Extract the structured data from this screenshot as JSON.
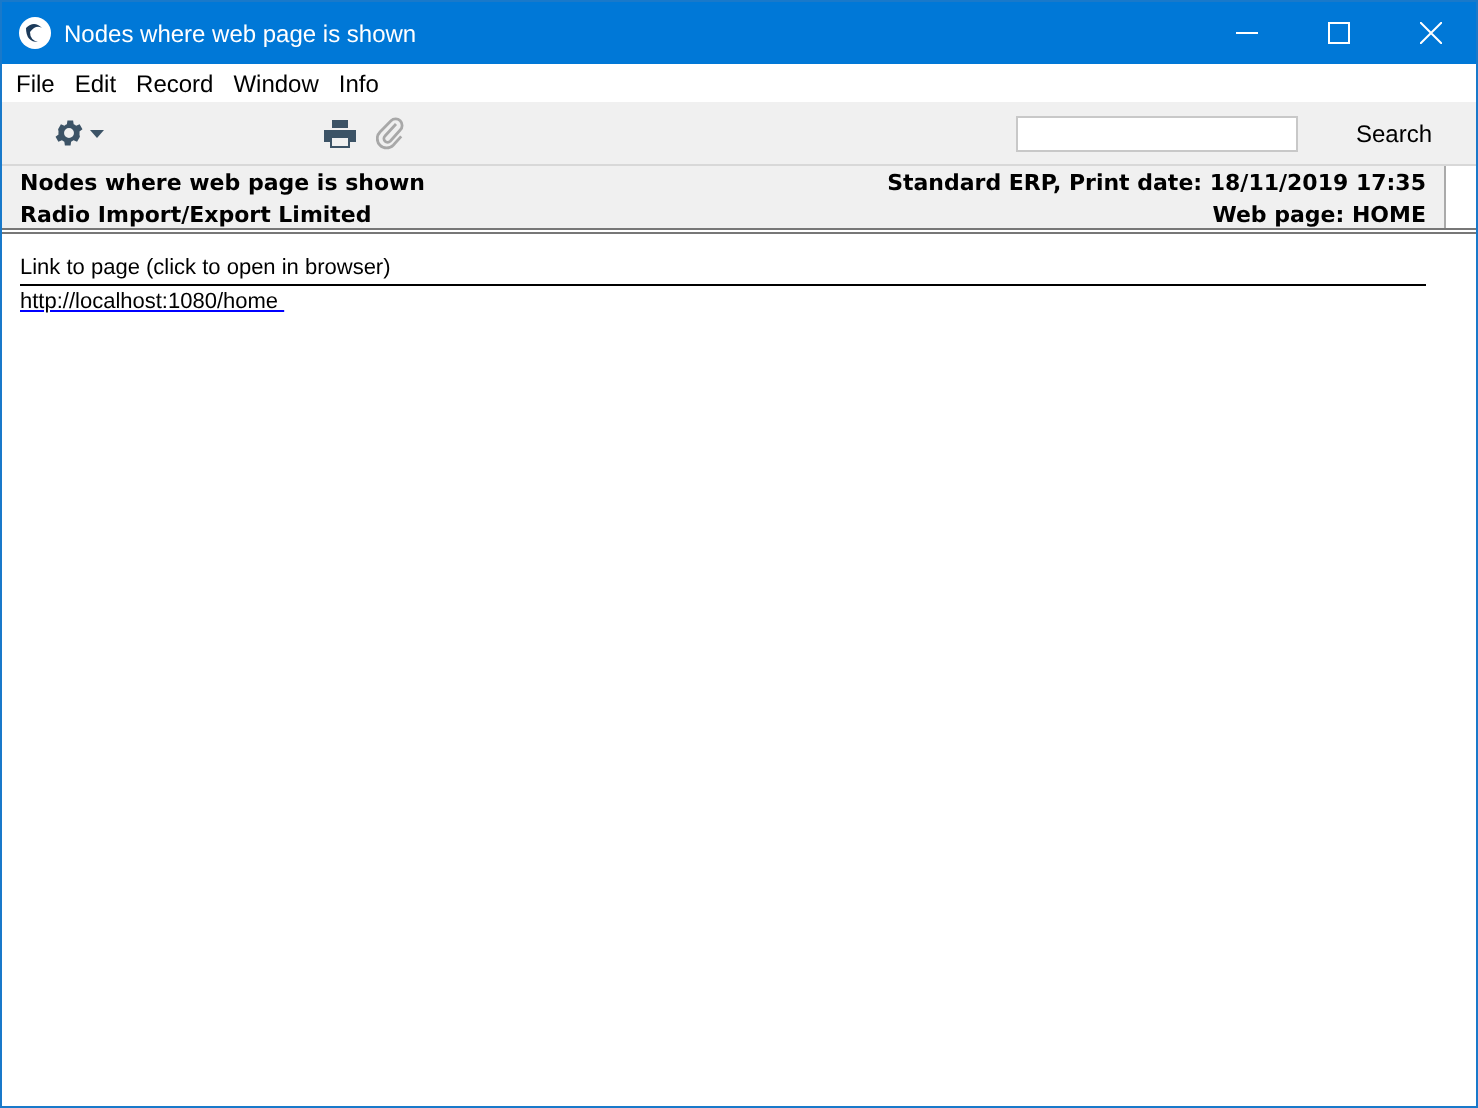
{
  "window": {
    "title": "Nodes where web page is shown"
  },
  "menu": [
    "File",
    "Edit",
    "Record",
    "Window",
    "Info"
  ],
  "toolbar": {
    "search_button": "Search"
  },
  "report_header": {
    "left": [
      "Nodes where web page is shown",
      "Radio Import/Export Limited"
    ],
    "right": [
      "Standard ERP, Print date: 18/11/2019 17:35",
      "Web page: HOME"
    ]
  },
  "link": {
    "label": "Link to page (click to open in browser)",
    "url": "http://localhost:1080/home "
  }
}
